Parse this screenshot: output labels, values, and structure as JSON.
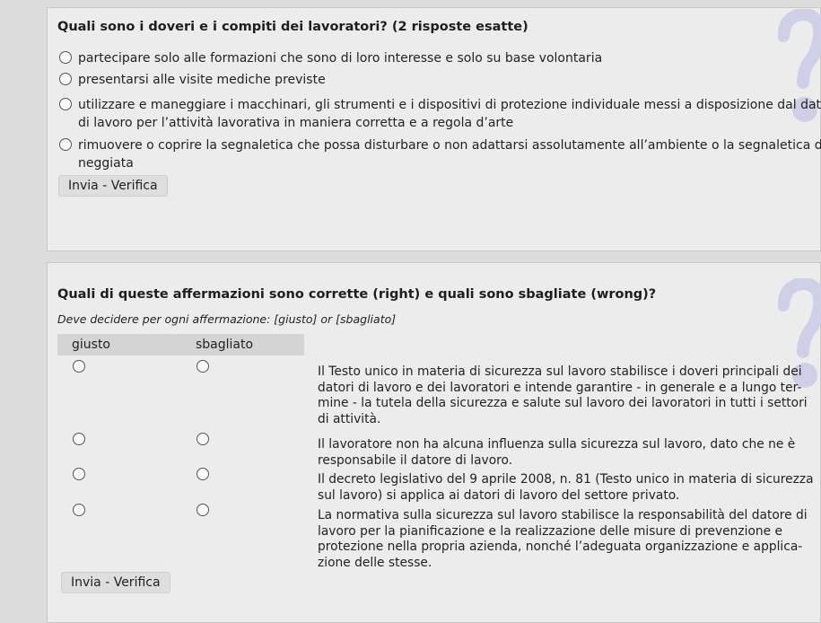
{
  "q1": {
    "title": "Quali sono i doveri e i compiti dei lavoratori? (2 risposte esatte)",
    "options": [
      {
        "lines": [
          "partecipare solo alle formazioni che sono di loro interesse e solo su base volontaria"
        ]
      },
      {
        "lines": [
          "presentarsi alle visite mediche previste"
        ]
      },
      {
        "lines": [
          "utilizzare e maneggiare i macchinari, gli strumenti e i dispositivi di protezione individuale messi a disposizione dal datore",
          "di lavoro per l’attività lavorativa in maniera corretta e a regola d’arte"
        ]
      },
      {
        "lines": [
          "rimuovere o coprire la segnaletica che possa disturbare o non adattarsi assolutamente all’ambiente o la segnaletica dan-",
          "neggiata"
        ]
      }
    ],
    "submit_label": "Invia - Verifica",
    "help_icon": "question-mark-icon"
  },
  "q2": {
    "title": "Quali di queste affermazioni sono corrette (right) e quali sono sbagliate (wrong)?",
    "instruction": "Deve decidere per ogni affermazione: [giusto] or [sbagliato]",
    "col_right": "giusto",
    "col_wrong": "sbagliato",
    "statements": [
      {
        "lines": [
          "Il Testo unico in materia di sicurezza sul lavoro stabilisce i doveri principali dei",
          "datori di lavoro e dei lavoratori e intende garantire - in generale e a lungo ter-",
          "mine - la tutela della sicurezza e salute sul lavoro dei lavoratori in tutti i settori",
          "di attività."
        ]
      },
      {
        "lines": [
          "Il lavoratore non ha alcuna influenza sulla sicurezza sul lavoro, dato che ne è",
          "responsabile il datore di lavoro."
        ]
      },
      {
        "lines": [
          "Il decreto legislativo del 9 aprile 2008, n. 81 (Testo unico in materia di sicurezza",
          "sul lavoro) si applica ai datori di lavoro del settore privato."
        ]
      },
      {
        "lines": [
          "La normativa sulla sicurezza sul lavoro stabilisce la responsabilità del datore di",
          "lavoro per la pianificazione e la realizzazione delle misure di prevenzione e",
          "protezione nella propria azienda, nonché l’adeguata organizzazione e applica-",
          "zione delle stesse."
        ]
      }
    ],
    "submit_label": "Invia - Verifica",
    "help_icon": "question-mark-icon"
  }
}
